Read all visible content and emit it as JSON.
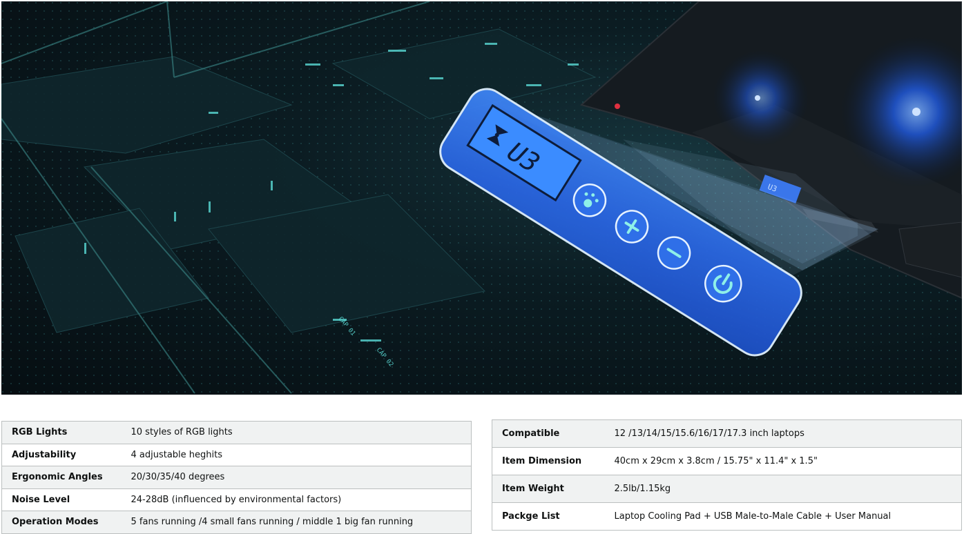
{
  "hero": {
    "panel_display": "U3",
    "panel_display_small": "U3",
    "board_label_1": "CAP 01",
    "board_label_2": "CAP 02",
    "icons": [
      "fan-icon",
      "rgb-light-icon",
      "fan-speed-up-icon",
      "fan-speed-down-icon",
      "power-icon"
    ]
  },
  "spec_left": [
    {
      "label": "RGB Lights",
      "value": "10 styles of RGB lights"
    },
    {
      "label": "Adjustability",
      "value": "4 adjustable heghits"
    },
    {
      "label": "Ergonomic Angles",
      "value": "20/30/35/40 degrees"
    },
    {
      "label": "Noise Level",
      "value": "24-28dB (influenced by environmental factors)"
    },
    {
      "label": "Operation Modes",
      "value": "5 fans running /4 small fans running / middle 1 big fan running"
    }
  ],
  "spec_right": [
    {
      "label": "Compatible",
      "value": "12 /13/14/15/15.6/16/17/17.3 inch laptops"
    },
    {
      "label": "Item Dimension",
      "value": "40cm x 29cm x 3.8cm / 15.75\" x 11.4\" x 1.5\""
    },
    {
      "label": "Item Weight",
      "value": "2.5lb/1.15kg"
    },
    {
      "label": "Packge List",
      "value": "Laptop Cooling Pad + USB Male-to-Male Cable + User Manual"
    }
  ],
  "colors": {
    "panel_blue": "#2f6fe8",
    "panel_glow": "#9cc4ff",
    "accent_cyan": "#5fe6e0",
    "row_stripe": "#f0f2f2",
    "border": "#bbbfbf"
  }
}
